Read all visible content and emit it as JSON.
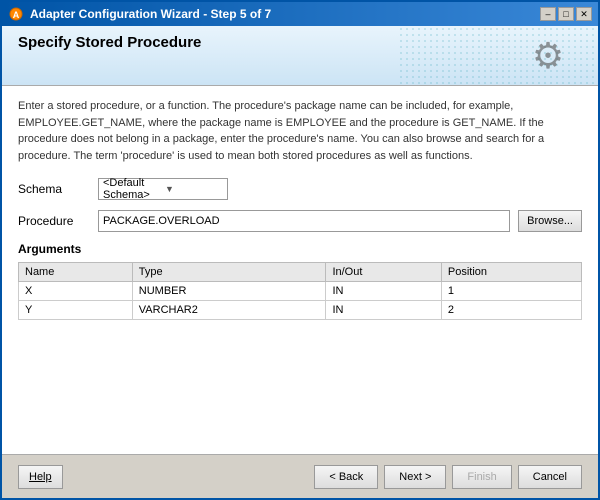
{
  "window": {
    "title": "Adapter Configuration Wizard - Step 5 of 7"
  },
  "header": {
    "title": "Specify Stored Procedure"
  },
  "description": "Enter a stored procedure, or a function. The procedure's package name can be included, for example, EMPLOYEE.GET_NAME, where the package name is EMPLOYEE and the procedure is GET_NAME.  If the procedure does not belong in a package, enter the procedure's name. You can also browse and search for a procedure. The term 'procedure' is used to mean both stored procedures as well as functions.",
  "form": {
    "schema_label": "Schema",
    "schema_value": "<Default Schema>",
    "procedure_label": "Procedure",
    "procedure_value": "PACKAGE.OVERLOAD",
    "browse_label": "Browse..."
  },
  "arguments": {
    "section_label": "Arguments",
    "columns": [
      "Name",
      "Type",
      "In/Out",
      "Position"
    ],
    "rows": [
      {
        "name": "X",
        "type": "NUMBER",
        "inout": "IN",
        "position": "1"
      },
      {
        "name": "Y",
        "type": "VARCHAR2",
        "inout": "IN",
        "position": "2"
      }
    ]
  },
  "footer": {
    "help_label": "Help",
    "back_label": "< Back",
    "next_label": "Next >",
    "finish_label": "Finish",
    "cancel_label": "Cancel"
  },
  "title_controls": {
    "minimize": "–",
    "maximize": "□",
    "close": "✕"
  }
}
